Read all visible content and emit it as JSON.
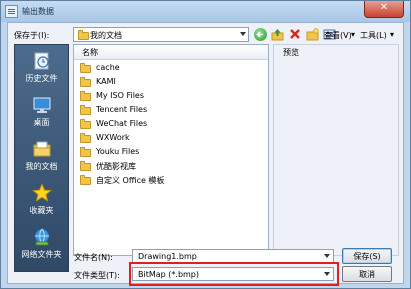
{
  "window": {
    "title": "输出数据",
    "close_glyph": "✕"
  },
  "save_in": {
    "label": "保存于(I):",
    "value": "我的文档"
  },
  "toolbar": {
    "back_icon": "back-arrow-icon",
    "up_icon": "up-folder-icon",
    "delete_icon": "delete-icon",
    "new_folder_icon": "new-folder-icon",
    "view_label": "查看(V)",
    "tools_label": "工具(L)"
  },
  "places": [
    {
      "label": "历史文件",
      "icon": "history-icon"
    },
    {
      "label": "桌面",
      "icon": "desktop-icon"
    },
    {
      "label": "我的文档",
      "icon": "my-documents-icon"
    },
    {
      "label": "收藏夹",
      "icon": "favorites-star-icon"
    },
    {
      "label": "网络文件夹",
      "icon": "network-folder-icon"
    }
  ],
  "file_list": {
    "column_header": "名称",
    "items": [
      "cache",
      "KAMI",
      "My ISO Files",
      "Tencent Files",
      "WeChat Files",
      "WXWork",
      "Youku Files",
      "优酷影视库",
      "自定义 Office 模板"
    ]
  },
  "preview": {
    "label": "预览"
  },
  "filename": {
    "label": "文件名(N):",
    "value": "Drawing1.bmp"
  },
  "filetype": {
    "label": "文件类型(T):",
    "value": "BitMap (*.bmp)"
  },
  "buttons": {
    "save": "保存(S)",
    "cancel": "取消"
  },
  "colors": {
    "highlight": "#e0201a",
    "places_bg": "#3c5777",
    "folder": "#f1c44a",
    "window_bg": "#bfd6ee"
  }
}
